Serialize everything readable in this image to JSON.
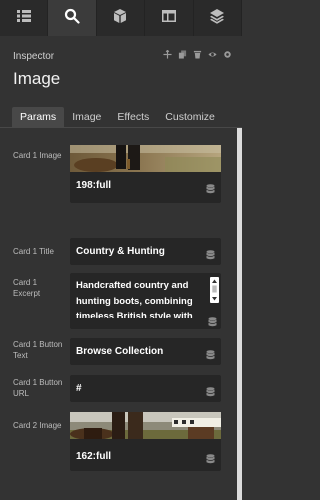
{
  "toolbar": {
    "buttons": [
      {
        "name": "list-icon",
        "active": false
      },
      {
        "name": "search-icon",
        "active": true
      },
      {
        "name": "cube-icon",
        "active": false
      },
      {
        "name": "layout-icon",
        "active": false
      },
      {
        "name": "layers-icon",
        "active": false
      }
    ]
  },
  "inspector": {
    "label": "Inspector",
    "title": "Image",
    "tools": [
      "move-icon",
      "copy-icon",
      "trash-icon",
      "eye-icon",
      "settings-icon"
    ]
  },
  "tabs": [
    {
      "label": "Params",
      "active": true
    },
    {
      "label": "Image",
      "active": false
    },
    {
      "label": "Effects",
      "active": false
    },
    {
      "label": "Customize",
      "active": false
    }
  ],
  "fields": {
    "card1_image": {
      "label": "Card 1 Image",
      "value": "198:full"
    },
    "card1_title": {
      "label": "Card 1 Title",
      "value": "Country & Hunting"
    },
    "card1_excerpt": {
      "label": "Card 1 Excerpt",
      "value": "Handcrafted country and hunting boots, combining timeless British style with"
    },
    "card1_button_text": {
      "label": "Card 1 Button Text",
      "value": "Browse Collection"
    },
    "card1_button_url": {
      "label": "Card 1 Button URL",
      "value": "#"
    },
    "card2_image": {
      "label": "Card 2 Image",
      "value": "162:full"
    }
  },
  "colors": {
    "panel": "#333333",
    "toolbar": "#2a2a2a",
    "field": "#262626",
    "active_tab": "#484848"
  }
}
